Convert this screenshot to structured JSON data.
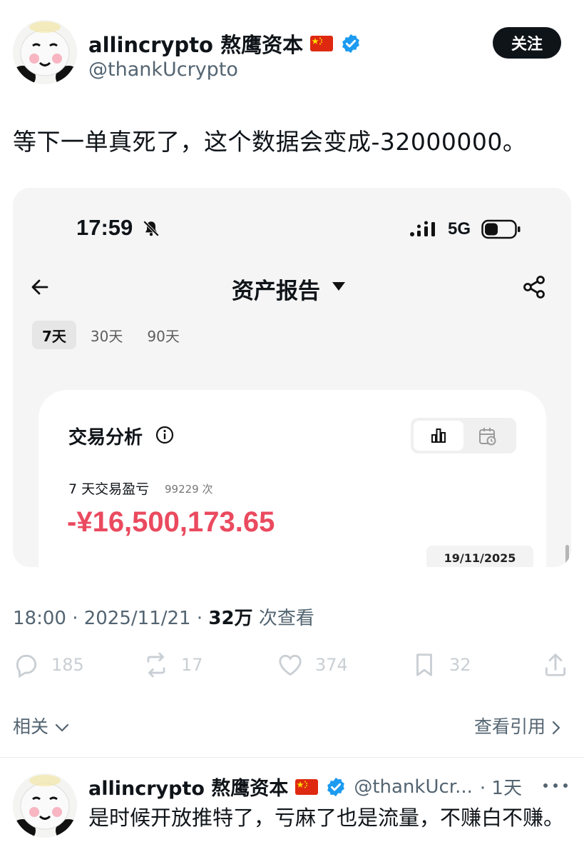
{
  "tweet": {
    "author": {
      "display_name": "allincrypto 熬鹰资本",
      "handle": "@thankUcrypto"
    },
    "follow_label": "关注",
    "text": "等下一单真死了，这个数据会变成-32000000。",
    "meta": {
      "time": "18:00 · 2025/11/21 · ",
      "views_count": "32万",
      "views_label": " 次查看"
    },
    "actions": {
      "replies": "185",
      "retweets": "17",
      "likes": "374",
      "bookmarks": "32"
    },
    "related_label": "相关",
    "quotes_label": "查看引用"
  },
  "screenshot": {
    "status_time": "17:59",
    "network": "5G",
    "title": "资产报告",
    "tabs": [
      {
        "label": "7天",
        "active": true
      },
      {
        "label": "30天"
      },
      {
        "label": "90天"
      }
    ],
    "card": {
      "title": "交易分析",
      "pnl_label": "7 天交易盈亏",
      "trade_count": "99229 次",
      "pnl_value": "-¥16,500,173.65",
      "date": "19/11/2025"
    }
  },
  "reply": {
    "display_name": "allincrypto 熬鹰资本",
    "handle": "@thankUcr...",
    "time": "· 1天",
    "text": "是时候开放推特了，亏麻了也是流量，不赚白不赚。"
  },
  "colors": {
    "loss_red": "#ea4a5f",
    "verified_blue": "#1d9bf0",
    "muted": "#536471"
  },
  "icons": [
    "panda-avatar",
    "china-flag-icon",
    "verified-badge-icon",
    "bell-muted-icon",
    "signal-icon",
    "battery-icon",
    "back-arrow-icon",
    "caret-down-icon",
    "share-icon",
    "info-icon",
    "bar-chart-icon",
    "calendar-icon",
    "reply-icon",
    "retweet-icon",
    "like-icon",
    "bookmark-icon",
    "share-upload-icon",
    "chevron-down-icon",
    "chevron-right-icon",
    "more-icon"
  ]
}
